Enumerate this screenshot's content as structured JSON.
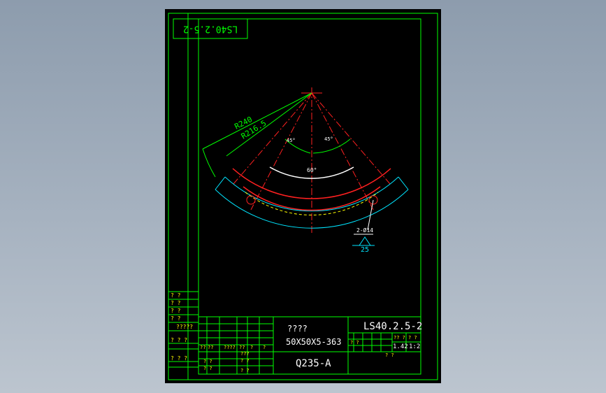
{
  "drawing": {
    "number": "LS40.2.5-2",
    "number_rotated": "LS40.2.5-2",
    "part_name": "????",
    "profile": "50X50X5-363",
    "material": "Q235-A",
    "scale": "1:2",
    "weight": "1.42",
    "scale_box_label": "? ?",
    "weight_box_label": "?? ?"
  },
  "dimensions": {
    "outer_radius": "R240",
    "inner_radius": "R216.5",
    "angle_left": "45°",
    "angle_right": "45°",
    "angle_center": "60°",
    "holes": "2-Ø14",
    "surface_finish": "25"
  },
  "left_strip": {
    "rows": [
      "? ?",
      "? ?",
      "? ?",
      "? ?",
      "?????"
    ]
  },
  "title_block": {
    "grid_headers": [
      "??",
      "??",
      "????",
      "??",
      "?",
      "?"
    ],
    "row_labels": [
      "? ? ?",
      "? ? ?"
    ],
    "small_cells": [
      "???",
      "? ?",
      "? ?",
      "? ?",
      "? ?",
      "? ?",
      "? ?"
    ]
  },
  "colors": {
    "frame": "#00ff00",
    "radius_outer": "#00ffff",
    "radius_inner": "#ff2020",
    "centerline": "#ff2020",
    "yellow": "#ffff00",
    "white": "#ffffff",
    "background": "#000000"
  }
}
